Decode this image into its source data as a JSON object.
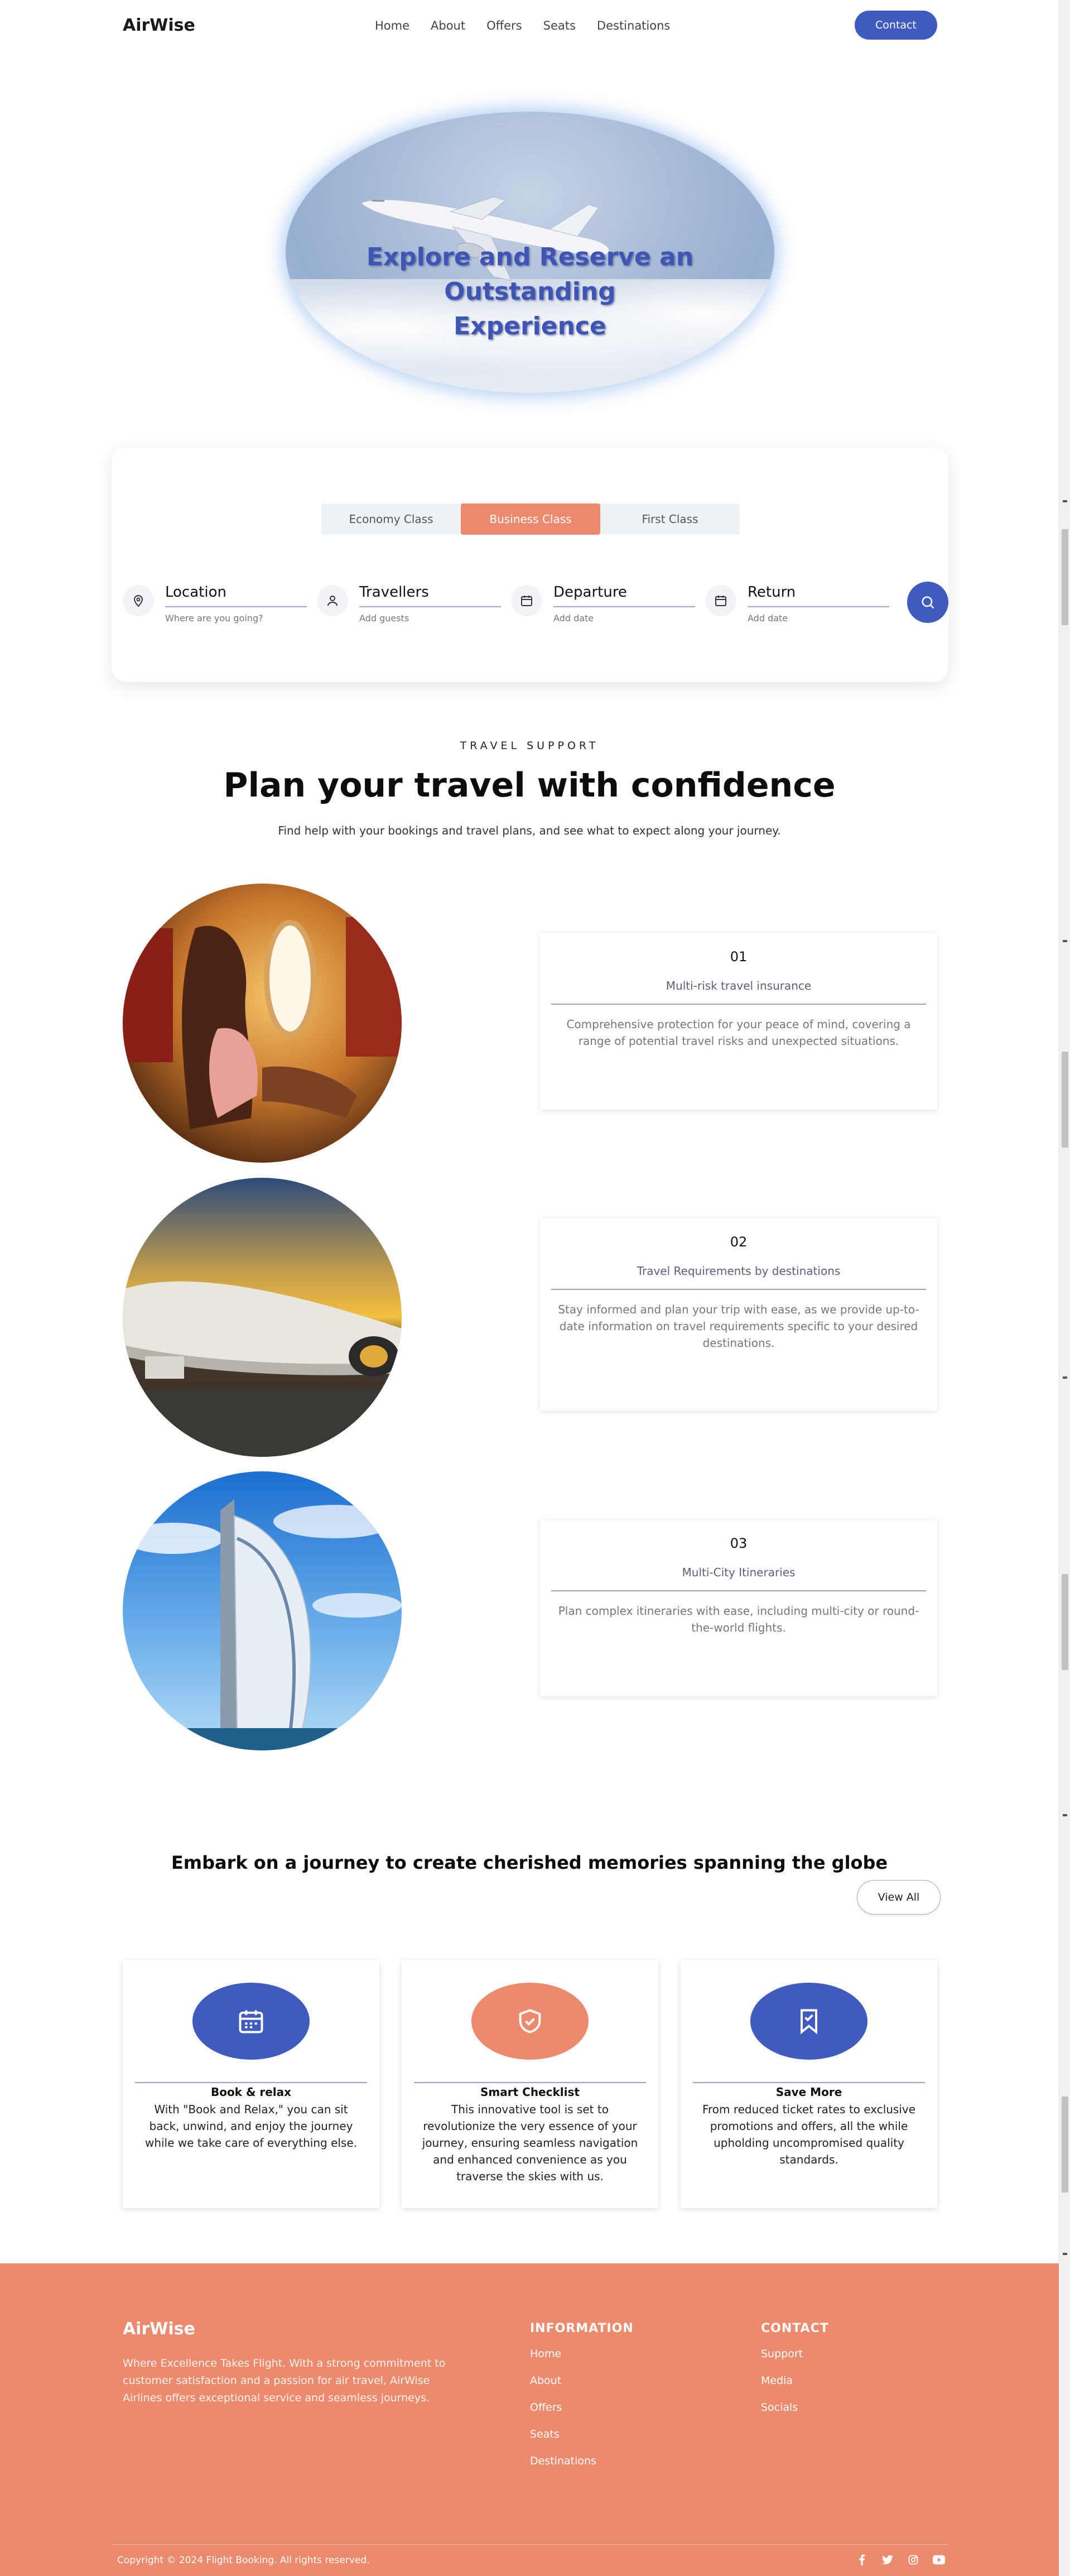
{
  "header": {
    "logo": "AirWise",
    "nav": [
      "Home",
      "About",
      "Offers",
      "Seats",
      "Destinations"
    ],
    "contact_label": "Contact"
  },
  "hero": {
    "title_line1": "Explore and Reserve an Outstanding",
    "title_line2": "Experience"
  },
  "search": {
    "classes": [
      "Economy Class",
      "Business Class",
      "First Class"
    ],
    "active_class": "Business Class",
    "fields": [
      {
        "label": "Location",
        "placeholder": "Where are you going?",
        "icon": "location-pin-icon"
      },
      {
        "label": "Travellers",
        "placeholder": "Add guests",
        "icon": "user-icon"
      },
      {
        "label": "Departure",
        "placeholder": "Add date",
        "icon": "calendar-icon"
      },
      {
        "label": "Return",
        "placeholder": "Add date",
        "icon": "calendar-icon"
      }
    ],
    "search_icon": "search-icon"
  },
  "support": {
    "eyebrow": "TRAVEL SUPPORT",
    "title": "Plan your travel with confidence",
    "subtitle": "Find help with your bookings and travel plans, and see what to expect along your journey.",
    "items": [
      {
        "num": "01",
        "title": "Multi-risk travel insurance",
        "desc": "Comprehensive protection for your peace of mind, covering a range of potential travel risks and unexpected situations."
      },
      {
        "num": "02",
        "title": "Travel Requirements by destinations",
        "desc": "Stay informed and plan your trip with ease, as we provide up-to-date information on travel requirements specific to your desired destinations."
      },
      {
        "num": "03",
        "title": "Multi-City Itineraries",
        "desc": "Plan complex itineraries with ease, including multi-city or round-the-world flights."
      }
    ]
  },
  "journey": {
    "title": "Embark on a journey to create cherished memories spanning the globe",
    "view_all": "View All",
    "cards": [
      {
        "name": "Book & relax",
        "desc": "With \"Book and Relax,\" you can sit back, unwind, and enjoy the journey while we take care of everything else.",
        "icon": "calendar-icon",
        "color": "#3f5bbf"
      },
      {
        "name": "Smart Checklist",
        "desc": "This innovative tool is set to revolutionize the very essence of your journey, ensuring seamless navigation and enhanced convenience as you traverse the skies with us.",
        "icon": "shield-check-icon",
        "color": "#eb8a6c"
      },
      {
        "name": "Save More",
        "desc": "From reduced ticket rates to exclusive promotions and offers, all the while upholding uncompromised quality standards.",
        "icon": "bookmark-icon",
        "color": "#3f5bbf"
      }
    ]
  },
  "footer": {
    "logo": "AirWise",
    "about": "Where Excellence Takes Flight. With a strong commitment to customer satisfaction and a passion for air travel, AirWise Airlines offers exceptional service and seamless journeys.",
    "info_title": "INFORMATION",
    "info_links": [
      "Home",
      "About",
      "Offers",
      "Seats",
      "Destinations"
    ],
    "contact_title": "CONTACT",
    "contact_links": [
      "Support",
      "Media",
      "Socials"
    ],
    "copyright": "Copyright © 2024 Flight Booking. All rights reserved.",
    "social": [
      "facebook-icon",
      "twitter-icon",
      "instagram-icon",
      "youtube-icon"
    ]
  },
  "colors": {
    "primary": "#3f5bbf",
    "accent": "#eb8a6c"
  }
}
